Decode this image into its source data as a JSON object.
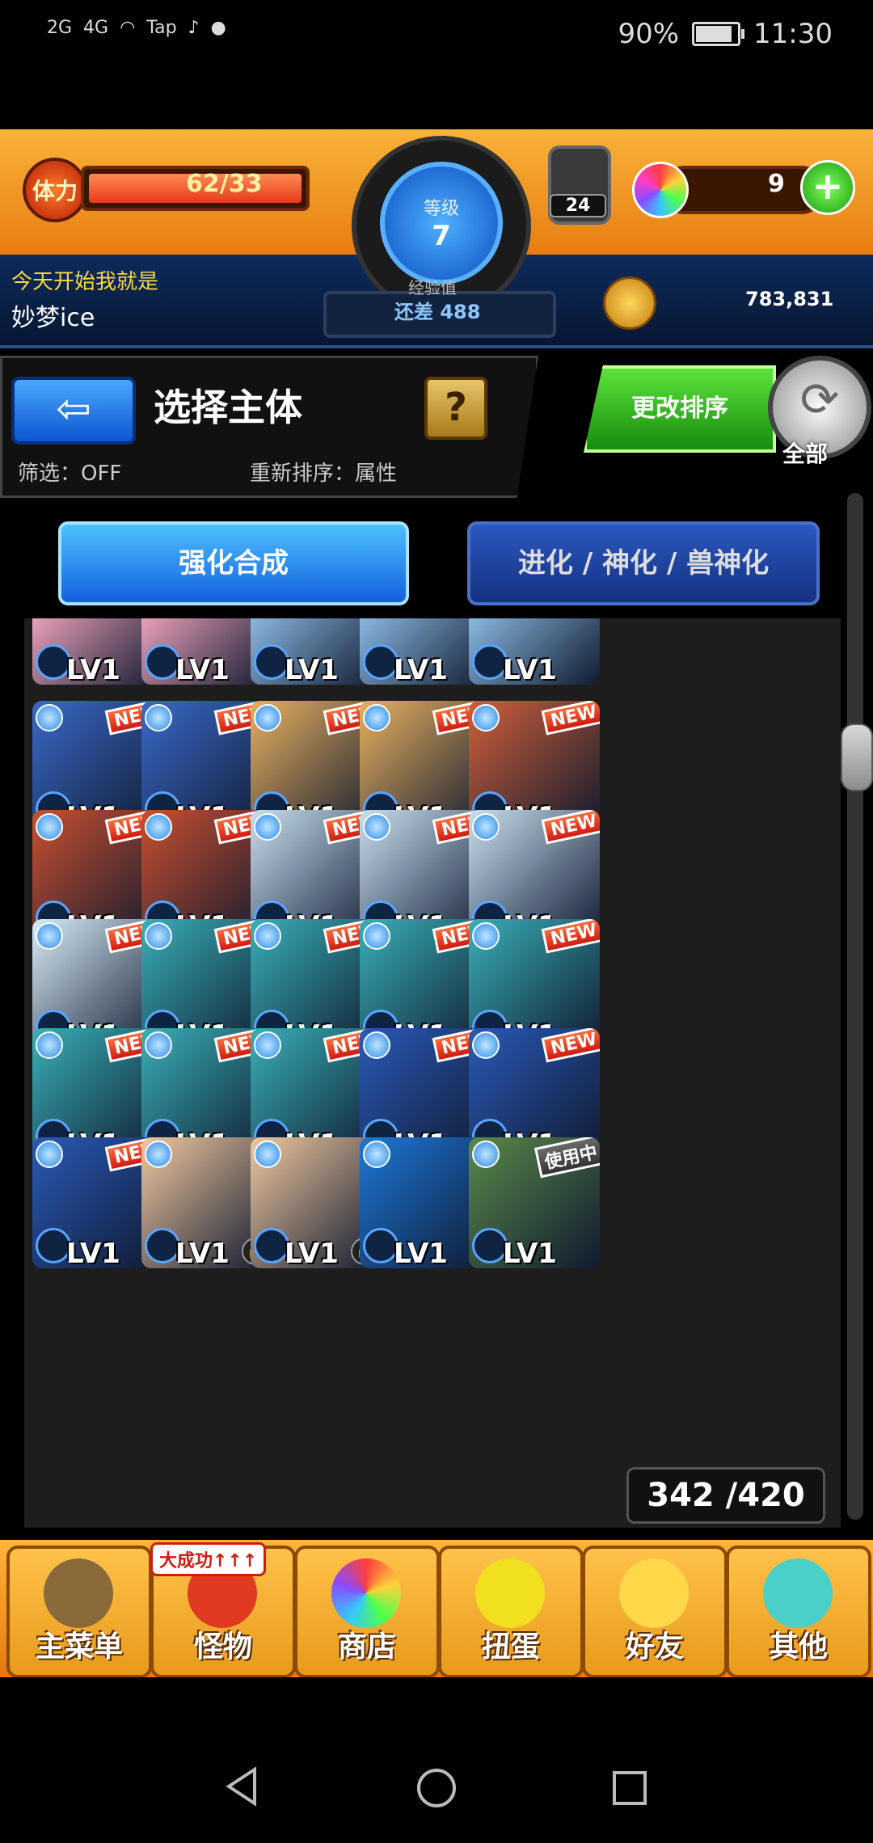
{
  "status_bar": {
    "network1": "2G",
    "network2": "4G",
    "app_tap": "Tap",
    "battery": "90%",
    "time": "11:30"
  },
  "header": {
    "stamina_label": "体力",
    "stamina_value": "62/33",
    "level_label": "等级",
    "level_value": "7",
    "exp_label": "经验值",
    "exp_remaining": "还差 488",
    "ticket_count": "24",
    "orb_count": "9",
    "greeting": "今天开始我就是",
    "username": "妙梦ice",
    "coins": "783,831"
  },
  "title_panel": {
    "back_label": "⇦",
    "title": "选择主体",
    "help_label": "?",
    "filter": "筛选：OFF",
    "resort": "重新排序：属性",
    "change_sort": "更改排序",
    "all": "全部"
  },
  "tabs": {
    "enhance": "强化合成",
    "evolve": "进化 / 神化 / 兽神化"
  },
  "grid": {
    "lvl_label": "LV1",
    "new_label": "NEW",
    "in_use_label": "使用中",
    "count": "342 /420",
    "rows": [
      [
        {
          "c": "#e8a0b8",
          "new": true
        },
        {
          "c": "#e8a0b8",
          "new": true
        },
        {
          "c": "#8ab8e0",
          "new": true
        },
        {
          "c": "#8ab8e0",
          "new": true
        },
        {
          "c": "#8ab8e0",
          "new": true
        }
      ],
      [
        {
          "c": "#3a6ac8",
          "new": true
        },
        {
          "c": "#3a6ac8",
          "new": true
        },
        {
          "c": "#e8b060",
          "new": true
        },
        {
          "c": "#e8b060",
          "new": true
        },
        {
          "c": "#d0603a",
          "new": true
        }
      ],
      [
        {
          "c": "#c85030",
          "new": true
        },
        {
          "c": "#c85030",
          "new": true
        },
        {
          "c": "#c8e0f0",
          "new": true
        },
        {
          "c": "#c8e0f0",
          "new": true
        },
        {
          "c": "#c8e0f0",
          "new": true
        }
      ],
      [
        {
          "c": "#d8ecf8",
          "new": true
        },
        {
          "c": "#3ab0b8",
          "new": true
        },
        {
          "c": "#3ab0b8",
          "new": true
        },
        {
          "c": "#3ab0b8",
          "new": true
        },
        {
          "c": "#3ab0b8",
          "new": true
        }
      ],
      [
        {
          "c": "#3ab0b8",
          "new": true
        },
        {
          "c": "#3ab0b8",
          "new": true
        },
        {
          "c": "#3ab0b8",
          "new": true
        },
        {
          "c": "#2a5ab8",
          "new": true
        },
        {
          "c": "#2a5ab8",
          "new": true
        }
      ],
      [
        {
          "c": "#2a5ab8",
          "new": true
        },
        {
          "c": "#f0c8a0",
          "new": false,
          "lock": true
        },
        {
          "c": "#f0c8a0",
          "new": false,
          "lock": true
        },
        {
          "c": "#1e78d8",
          "new": false
        },
        {
          "c": "#5a8a4a",
          "new": false,
          "in_use": true
        }
      ]
    ]
  },
  "bottom_nav": {
    "items": [
      "主菜单",
      "怪物",
      "商店",
      "扭蛋",
      "好友",
      "其他"
    ],
    "monster_flag": "大成功↑↑↑"
  },
  "colors": {
    "accent_orange": "#f8b23a",
    "header_blue": "#0e2b5c",
    "tab_blue": "#1460e0",
    "sort_green": "#5ce33a"
  }
}
